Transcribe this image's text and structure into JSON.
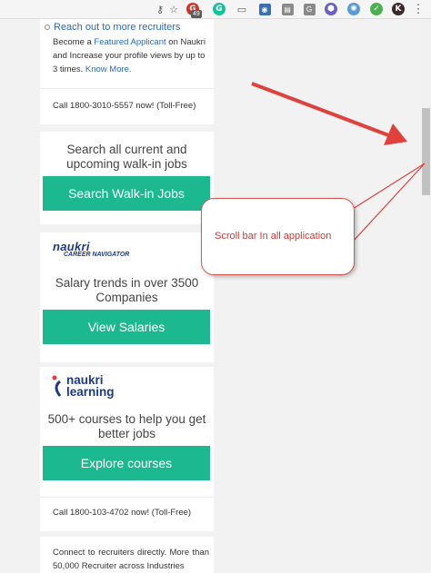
{
  "browser": {
    "extension_badge": "49",
    "extension_g1": "G",
    "extension_g2": "G",
    "extension_k": "K"
  },
  "recruiters_card": {
    "title": "Reach out to more recruiters",
    "body_1": "Become a",
    "link_featured": "Featured Applicant",
    "body_2": "on Naukri and Increase your profile views by up to 3 times.",
    "link_know_more": "Know More.",
    "call": "Call 1800-3010-5557 now! (Toll-Free)"
  },
  "walkin_card": {
    "text": "Search all current and upcoming walk-in jobs",
    "button": "Search Walk-in Jobs"
  },
  "salary_card": {
    "logo_main": "naukri",
    "logo_sub": "CAREER NAVIGATOR",
    "text": "Salary trends in over 3500 Companies",
    "button": "View Salaries"
  },
  "learning_card": {
    "logo_line1": "naukri",
    "logo_line2": "learning",
    "text": "500+ courses to help you get better jobs",
    "button": "Explore courses",
    "call": "Call 1800-103-4702 now! (Toll-Free)"
  },
  "connect_card": {
    "text": "Connect to recruiters directly. More than 50,000 Recruiter across Industries"
  },
  "annotation": {
    "callout": "Scroll bar In all application",
    "color": "#e0413c"
  }
}
